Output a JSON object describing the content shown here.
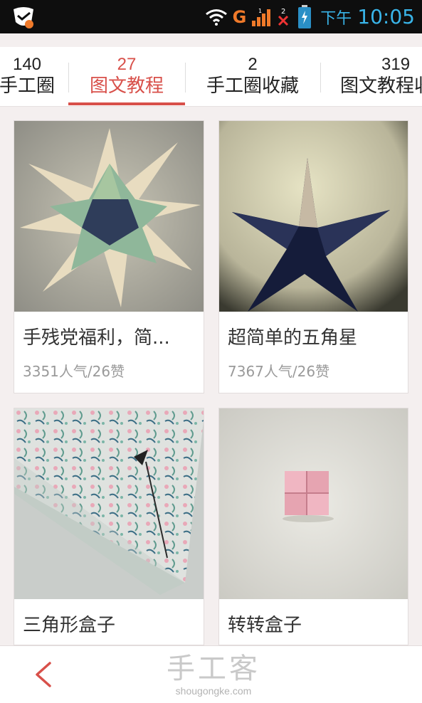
{
  "status_bar": {
    "network": "G",
    "time_prefix": "下午",
    "time": "10:05",
    "notification_count": "2",
    "signal_digit": "1",
    "colors": {
      "background": "#0e0e0e",
      "accent": "#39b4e8",
      "network": "#f07a2a"
    }
  },
  "tabs": [
    {
      "count": "140",
      "label": "手工圈",
      "active": false
    },
    {
      "count": "27",
      "label": "图文教程",
      "active": true
    },
    {
      "count": "2",
      "label": "手工圈收藏",
      "active": false
    },
    {
      "count": "319",
      "label": "图文教程收藏",
      "active": false
    }
  ],
  "cards": [
    {
      "title": "手残党福利，简...",
      "meta": "3351人气/26赞",
      "thumb": "origami-star-green"
    },
    {
      "title": "超简单的五角星",
      "meta": "7367人气/26赞",
      "thumb": "origami-star-dark"
    },
    {
      "title": "三角形盒子",
      "meta": "",
      "thumb": "triangle-box"
    },
    {
      "title": "转转盒子",
      "meta": "",
      "thumb": "pink-box"
    }
  ],
  "bottom_bar": {
    "back_icon": "chevron-left-icon",
    "brand_name": "手工客",
    "brand_url": "shougongke.com"
  },
  "colors": {
    "active_tab": "#d8504a",
    "page_bg": "#f4efef"
  }
}
